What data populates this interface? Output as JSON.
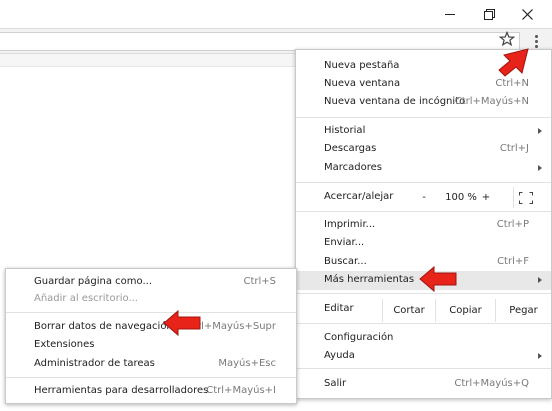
{
  "window": {
    "minimize_icon": "minimize-icon",
    "restore_icon": "restore-icon",
    "close_icon": "close-icon"
  },
  "toolbar": {
    "star_icon": "star-icon",
    "menu_icon": "more-vertical-icon"
  },
  "menu": {
    "new_tab": {
      "label": "Nueva pestaña",
      "shortcut": ""
    },
    "new_window": {
      "label": "Nueva ventana",
      "shortcut": "Ctrl+N"
    },
    "incognito": {
      "label": "Nueva ventana de incógnito",
      "shortcut": "Ctrl+Mayús+N"
    },
    "history": {
      "label": "Historial"
    },
    "downloads": {
      "label": "Descargas",
      "shortcut": "Ctrl+J"
    },
    "bookmarks": {
      "label": "Marcadores"
    },
    "zoom": {
      "label": "Acercar/alejar",
      "minus": "-",
      "value": "100 %",
      "plus": "+"
    },
    "print": {
      "label": "Imprimir...",
      "shortcut": "Ctrl+P"
    },
    "cast": {
      "label": "Enviar..."
    },
    "find": {
      "label": "Buscar...",
      "shortcut": "Ctrl+F"
    },
    "more_tools": {
      "label": "Más herramientas"
    },
    "edit": {
      "label": "Editar",
      "cut": "Cortar",
      "copy": "Copiar",
      "paste": "Pegar"
    },
    "settings": {
      "label": "Configuración"
    },
    "help": {
      "label": "Ayuda"
    },
    "exit": {
      "label": "Salir",
      "shortcut": "Ctrl+Mayús+Q"
    }
  },
  "submenu": {
    "save_page": {
      "label": "Guardar página como...",
      "shortcut": "Ctrl+S"
    },
    "add_desktop": {
      "label": "Añadir al escritorio..."
    },
    "clear_data": {
      "label": "Borrar datos de navegación...",
      "shortcut": "Ctrl+Mayús+Supr"
    },
    "extensions": {
      "label": "Extensiones"
    },
    "task_manager": {
      "label": "Administrador de tareas",
      "shortcut": "Mayús+Esc"
    },
    "dev_tools": {
      "label": "Herramientas para desarrolladores",
      "shortcut": "Ctrl+Mayús+I"
    }
  },
  "colors": {
    "annotation_arrow": "#e8231a"
  }
}
